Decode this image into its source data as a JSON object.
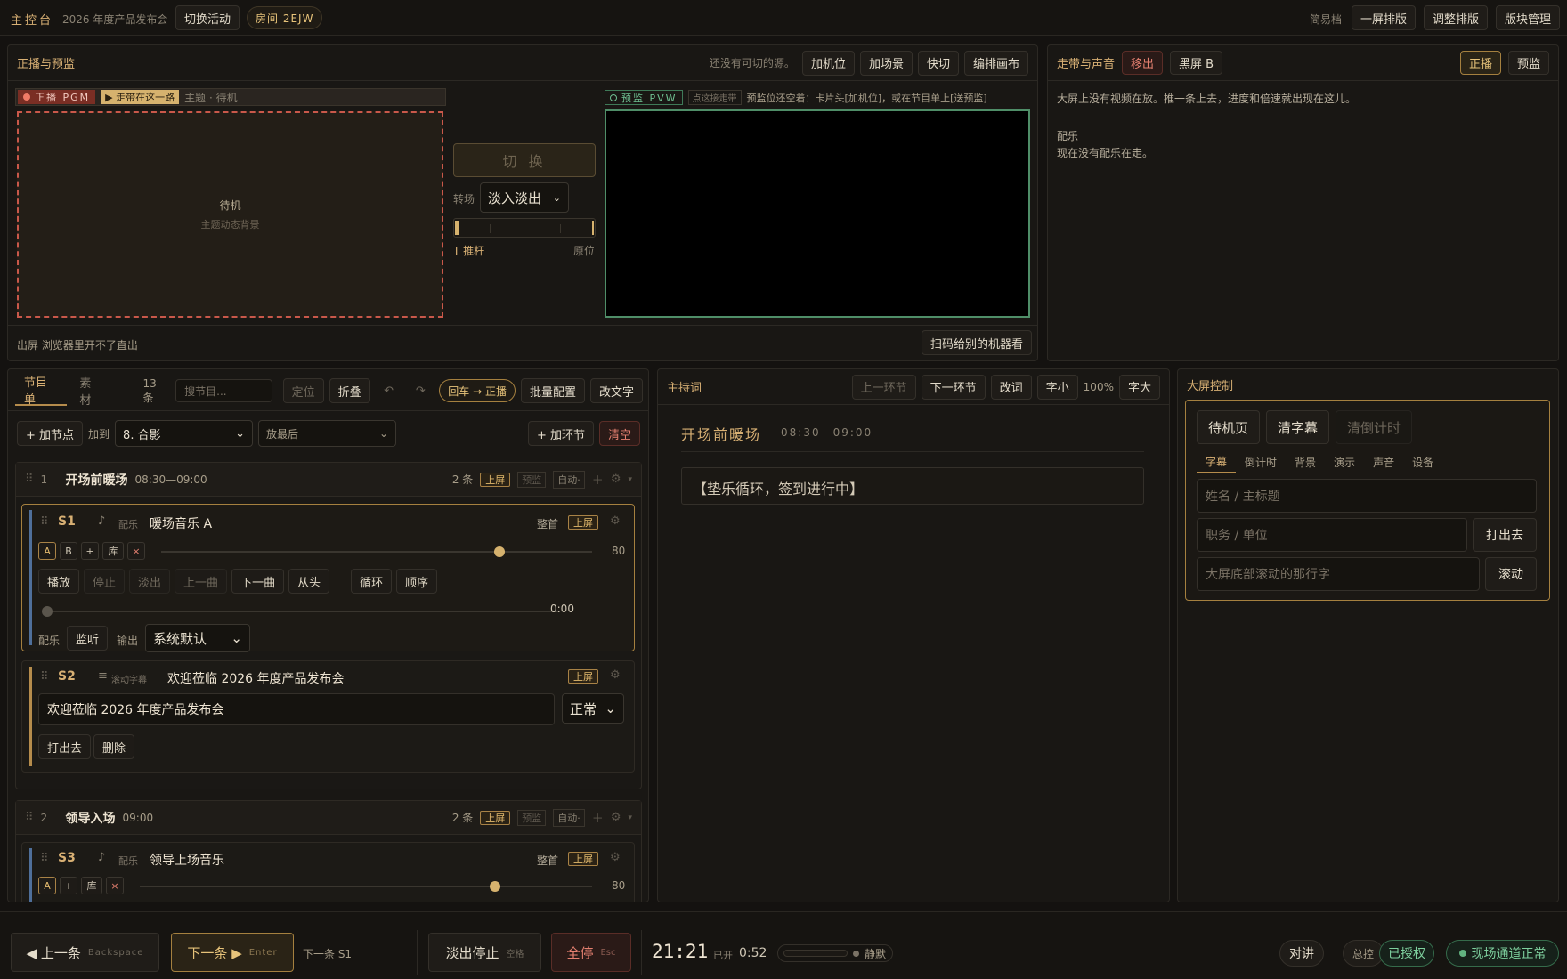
{
  "topbar": {
    "title": "主控台",
    "event": "2026 年度产品发布会",
    "switch": "切换活动",
    "room": "房间 2EJW",
    "simple": "简易档",
    "one_screen": "一屏排版",
    "adjust": "调整排版",
    "blocks": "版块管理"
  },
  "pp": {
    "title": "正播与预监",
    "no_source": "还没有可切的源。",
    "add_cam": "加机位",
    "add_scene": "加场景",
    "quick_cut": "快切",
    "edit_canvas": "编排画布",
    "pgm_badge": "正播 PGM",
    "walk_badge": "▶ 走带在这一路",
    "theme_label": "主题 · 待机",
    "pgm_main": "待机",
    "pgm_sub": "主题动态背景",
    "cut": "切 换",
    "transition_label": "转场",
    "transition_value": "淡入淡出",
    "tbar_label": "T 推杆",
    "tbar_origin": "原位",
    "pvw_badge": "预监 PVW",
    "pvw_walk": "点这接走带",
    "pvw_hint": "预监位还空着：卡片头[加机位]，或在节目单上[送预监]",
    "output_note": "出屏 浏览器里开不了直出",
    "scan": "扫码给别的机器看"
  },
  "walk": {
    "title": "走带与声音",
    "move_out": "移出",
    "black": "黑屏 B",
    "live": "正播",
    "preview": "预监",
    "no_video": "大屏上没有视频在放。推一条上去，进度和倍速就出现在这儿。",
    "music_label": "配乐",
    "no_music": "现在没有配乐在走。"
  },
  "rundown": {
    "tab1": "节目单",
    "tab2": "素材",
    "count": "13 条",
    "search_ph": "搜节目...",
    "locate": "定位",
    "fold": "折叠",
    "back_live": "回车 → 正播",
    "batch": "批量配置",
    "edit_text": "改文字",
    "add_point": "+ 加节点",
    "add_to": "加到",
    "target": "8. 合影",
    "position": "放最后",
    "add_section": "+ 加环节",
    "clear": "清空",
    "sec1": {
      "num": "1",
      "name": "开场前暖场",
      "time": "08:30—09:00",
      "count": "2 条",
      "up": "上屏",
      "pre": "预监",
      "auto": "自动·"
    },
    "s1": {
      "id": "S1",
      "type": "配乐",
      "name": "暖场音乐 A",
      "whole": "整首",
      "up": "上屏",
      "vol": "80",
      "play": "播放",
      "stop": "停止",
      "fade": "淡出",
      "prev": "上一曲",
      "next": "下一曲",
      "from_start": "从头",
      "loop": "循环",
      "order": "顺序",
      "time": "0:00",
      "bgm": "配乐",
      "monitor": "监听",
      "output": "输出",
      "device": "系统默认"
    },
    "s2": {
      "id": "S2",
      "type": "滚动字幕",
      "name": "欢迎莅临 2026 年度产品发布会",
      "up": "上屏",
      "text": "欢迎莅临 2026 年度产品发布会",
      "speed": "正常",
      "send": "打出去",
      "delete": "删除"
    },
    "sec2": {
      "num": "2",
      "name": "领导入场",
      "time": "09:00",
      "count": "2 条",
      "up": "上屏",
      "pre": "预监",
      "auto": "自动·"
    },
    "s3": {
      "id": "S3",
      "type": "配乐",
      "name": "领导上场音乐",
      "whole": "整首",
      "up": "上屏",
      "vol": "80"
    },
    "chips": {
      "a": "A",
      "b": "B",
      "plus": "+",
      "lib": "库",
      "x": "×"
    }
  },
  "host": {
    "title": "主持词",
    "prev": "上一环节",
    "next": "下一环节",
    "edit": "改词",
    "smaller": "字小",
    "zoom": "100%",
    "bigger": "字大",
    "section": "开场前暖场",
    "time": "08:30—09:00",
    "script": "【垫乐循环，签到进行中】"
  },
  "screen": {
    "title": "大屏控制",
    "standby": "待机页",
    "clear_sub": "清字幕",
    "clear_timer": "清倒计时",
    "tabs": [
      "字幕",
      "倒计时",
      "背景",
      "演示",
      "声音",
      "设备"
    ],
    "name_ph": "姓名 / 主标题",
    "title_ph": "职务 / 单位",
    "send": "打出去",
    "ticker_ph": "大屏底部滚动的那行字",
    "scroll": "滚动"
  },
  "bottom": {
    "prev": "◀ 上一条",
    "prev_key": "Backspace",
    "next": "下一条 ▶",
    "next_key": "Enter",
    "next_info": "下一条 S1",
    "fade_stop": "淡出停止",
    "fade_key": "空格",
    "all_stop": "全停",
    "all_key": "Esc",
    "clock": "21:21",
    "elapsed_label": "已开",
    "elapsed": "0:52",
    "silent": "静默",
    "talk": "对讲",
    "master": "总控",
    "authorized": "已授权",
    "channel": "现场通道正常"
  },
  "colors": {
    "accent": "#d8b074",
    "pgm_red": "#c9584a",
    "pvw_green": "#5aa87a",
    "ok_green": "#62b380"
  }
}
